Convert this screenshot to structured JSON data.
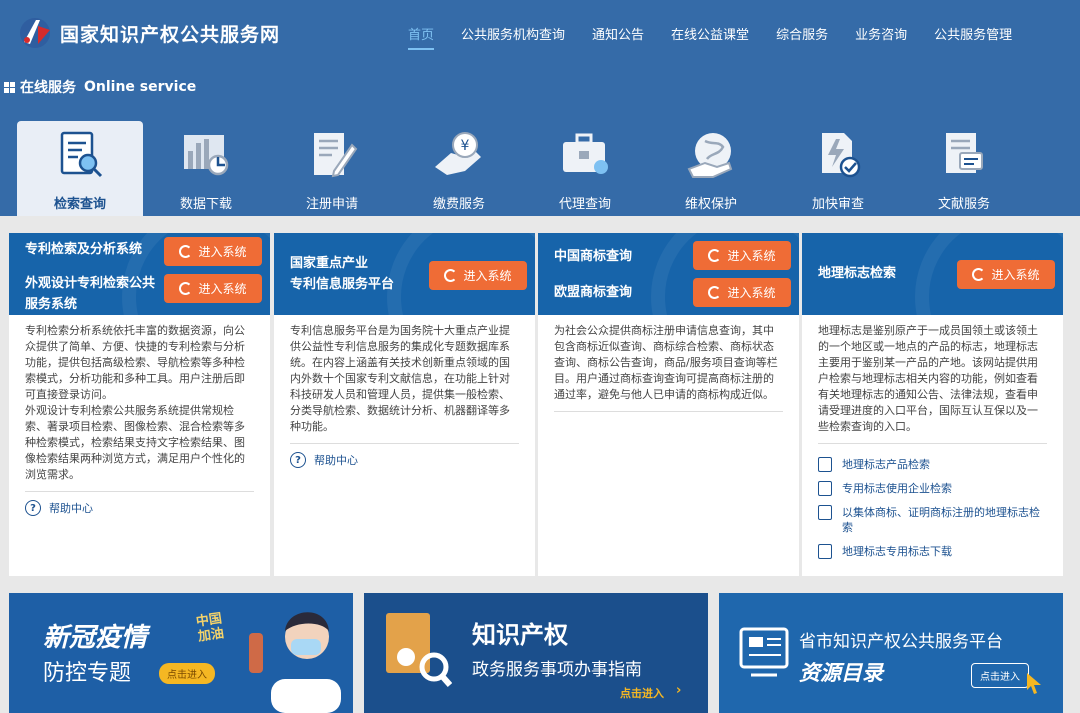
{
  "header": {
    "site_title": "国家知识产权公共服务网",
    "nav": [
      "首页",
      "公共服务机构查询",
      "通知公告",
      "在线公益课堂",
      "综合服务",
      "业务咨询",
      "公共服务管理"
    ]
  },
  "section": {
    "title": "在线服务",
    "title_en": "Online service"
  },
  "tabs": [
    {
      "label": "检索查询",
      "icon": "search-doc-icon"
    },
    {
      "label": "数据下载",
      "icon": "bar-chart-icon"
    },
    {
      "label": "注册申请",
      "icon": "edit-doc-icon"
    },
    {
      "label": "缴费服务",
      "icon": "payment-icon"
    },
    {
      "label": "代理查询",
      "icon": "briefcase-icon"
    },
    {
      "label": "维权保护",
      "icon": "globe-hand-icon"
    },
    {
      "label": "加快审查",
      "icon": "fast-check-icon"
    },
    {
      "label": "文献服务",
      "icon": "document-icon"
    }
  ],
  "enter_label": "进入系统",
  "help_label": "帮助中心",
  "panels": {
    "patent": {
      "title1": "专利检索及分析系统",
      "title2": "外观设计专利检索公共服务系统",
      "desc": "专利检索分析系统依托丰富的数据资源，向公众提供了简单、方便、快捷的专利检索与分析功能，提供包括高级检索、导航检索等多种检索模式，分析功能和多种工具。用户注册后即可直接登录访问。\n外观设计专利检索公共服务系统提供常规检索、著录项目检索、图像检索、混合检索等多种检索模式，检索结果支持文字检索结果、图像检索结果两种浏览方式，满足用户个性化的浏览需求。"
    },
    "key_industry": {
      "title": "国家重点产业\n专利信息服务平台",
      "desc": "专利信息服务平台是为国务院十大重点产业提供公益性专利信息服务的集成化专题数据库系统。在内容上涵盖有关技术创新重点领域的国内外数十个国家专利文献信息，在功能上针对科技研发人员和管理人员，提供集一般检索、分类导航检索、数据统计分析、机器翻译等多种功能。"
    },
    "trademark": {
      "title1": "中国商标查询",
      "title2": "欧盟商标查询",
      "desc": "为社会公众提供商标注册申请信息查询，其中包含商标近似查询、商标综合检索、商标状态查询、商标公告查询，商品/服务项目查询等栏目。用户通过商标查询查询可提高商标注册的通过率，避免与他人已申请的商标构成近似。"
    },
    "geo": {
      "title": "地理标志检索",
      "desc": "地理标志是鉴别原产于一成员国领土或该领土的一个地区或一地点的产品的标志，地理标志主要用于鉴别某一产品的产地。该网站提供用户检索与地理标志相关内容的功能，例如查看有关地理标志的通知公告、法律法规，查看申请受理进度的入口平台，国际互认互保以及一些检索查询的入口。",
      "links": [
        "地理标志产品检索",
        "专用标志使用企业检索",
        "以集体商标、证明商标注册的地理标志检索",
        "地理标志专用标志下载"
      ]
    }
  },
  "banners": {
    "covid": {
      "title1": "新冠疫情",
      "title2": "防控专题",
      "badge": "中国\n加油",
      "button": "点击进入"
    },
    "guide": {
      "title1": "知识产权",
      "title2": "政务服务事项办事指南",
      "button": "点击进入"
    },
    "platform": {
      "title1": "省市知识产权公共服务平台",
      "title2": "资源目录",
      "button": "点击进入"
    }
  }
}
